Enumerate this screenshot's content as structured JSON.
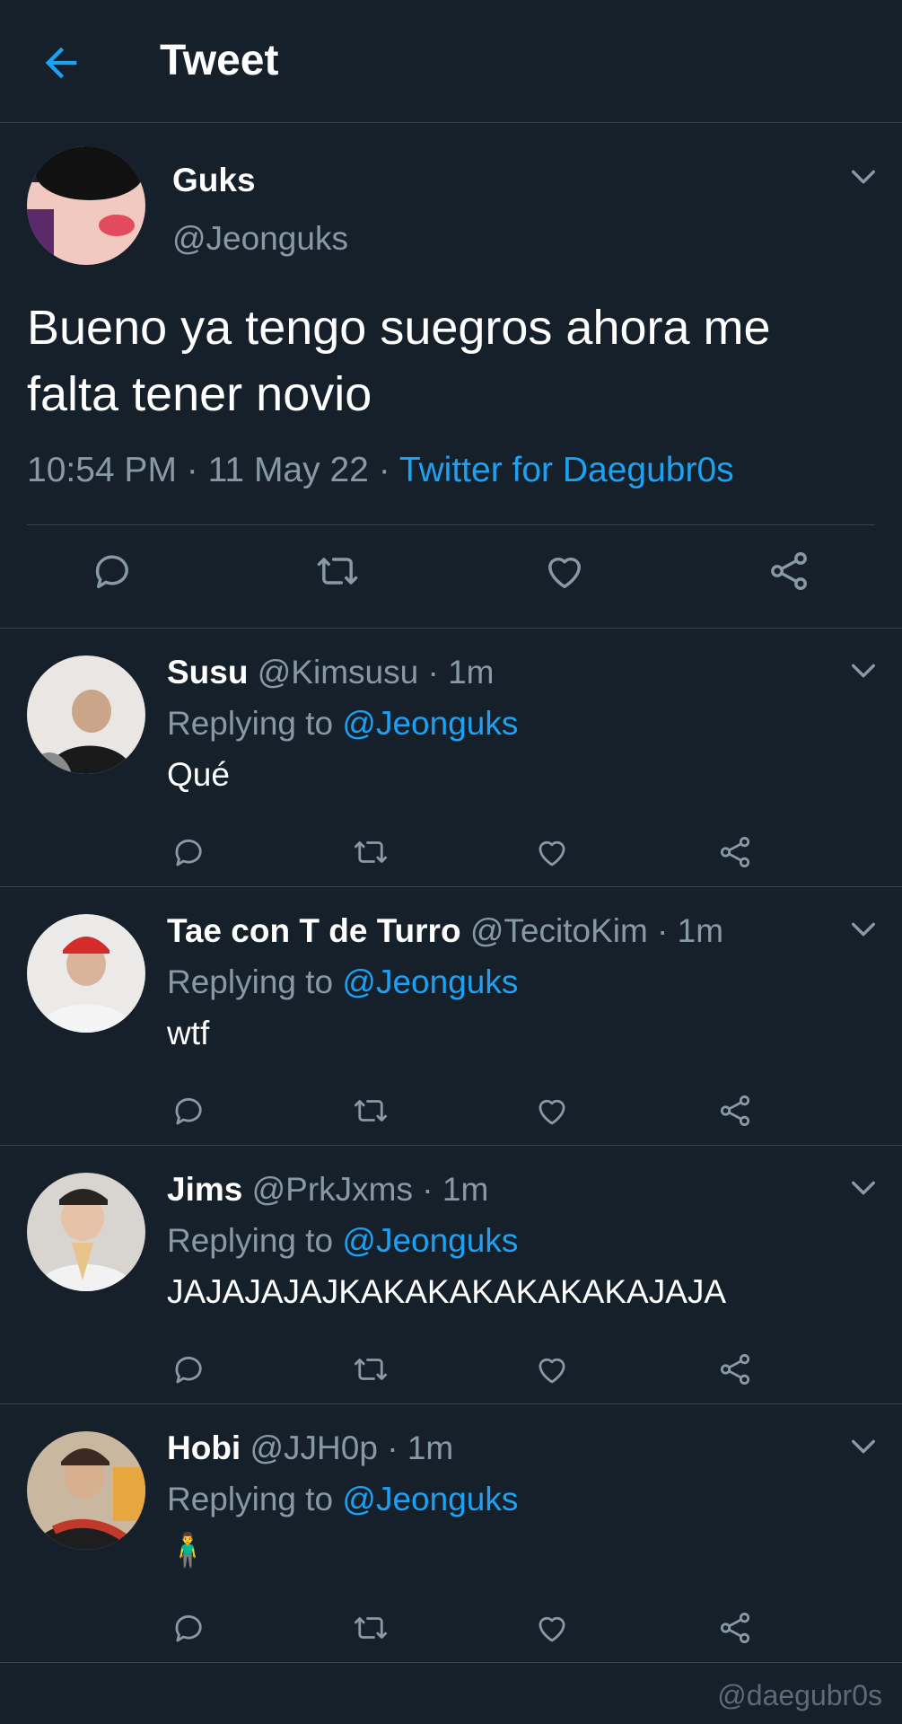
{
  "header": {
    "title": "Tweet",
    "back_icon": "arrow-left-icon",
    "accent": "#1da1f2"
  },
  "main_tweet": {
    "name": "Guks",
    "handle": "@Jeonguks",
    "text": "Bueno ya tengo suegros ahora me falta tener novio",
    "time": "10:54 PM",
    "date": "11 May 22",
    "source": "Twitter for Daegubr0s",
    "sep": "·"
  },
  "replies": [
    {
      "name": "Susu",
      "handle": "@Kimsusu",
      "time": "1m",
      "replying_label": "Replying to",
      "replying_to": "@Jeonguks",
      "text": "Qué"
    },
    {
      "name": "Tae con T de Turro",
      "handle": "@TecitoKim",
      "time": "1m",
      "replying_label": "Replying to",
      "replying_to": "@Jeonguks",
      "text": "wtf"
    },
    {
      "name": "Jims",
      "handle": "@PrkJxms",
      "time": "1m",
      "replying_label": "Replying to",
      "replying_to": "@Jeonguks",
      "text": "JAJAJAJAJKAKAKAKAKAKAKAJAJA"
    },
    {
      "name": "Hobi",
      "handle": "@JJH0p",
      "time": "1m",
      "replying_label": "Replying to",
      "replying_to": "@Jeonguks",
      "text": "🧍‍♂️"
    }
  ],
  "sep": "·",
  "watermark": "@daegubr0s",
  "colors": {
    "background": "#15202b",
    "divider": "#38444d",
    "muted": "#8899a6",
    "link": "#1da1f2"
  }
}
